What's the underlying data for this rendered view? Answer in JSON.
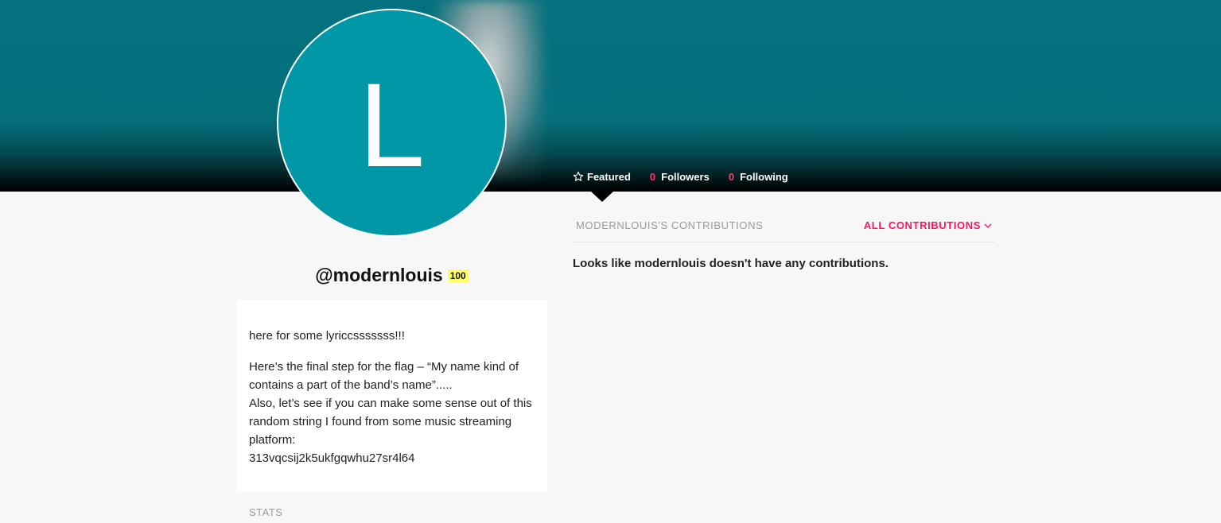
{
  "profile": {
    "avatar_letter": "L",
    "username": "@modernlouis",
    "iq": "100"
  },
  "tabs": {
    "featured_label": "Featured",
    "followers_count": "0",
    "followers_label": "Followers",
    "following_count": "0",
    "following_label": "Following"
  },
  "bio": {
    "line1": "here for some lyriccsssssss!!!",
    "line2": "Here’s the final step for the flag – “My name kind of contains a part of the band’s name”.....",
    "line3": "Also, let’s see if you can make some sense out of this random string I found from some music streaming platform:",
    "line4": "313vqcsij2k5ukfgqwhu27sr4l64"
  },
  "stats_label": "STATS",
  "contributions": {
    "title": "MODERNLOUIS'S CONTRIBUTIONS",
    "filter_label": "ALL CONTRIBUTIONS",
    "empty_message": "Looks like modernlouis doesn't have any contributions."
  },
  "colors": {
    "banner": "#03717f",
    "avatar_bg": "#0097a7",
    "accent_pink": "#ff1464",
    "iq_badge": "#ffff64"
  },
  "icons": [
    "star-icon",
    "chevron-down-icon"
  ]
}
